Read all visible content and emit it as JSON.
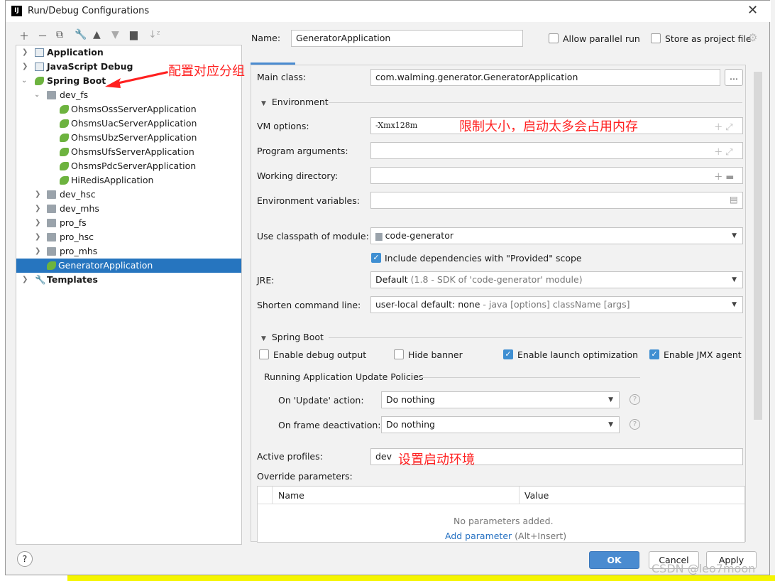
{
  "window": {
    "title": "Run/Debug Configurations",
    "logo": "IJ"
  },
  "toolbar": {
    "icons": [
      "plus-icon",
      "minus-icon",
      "copy-icon",
      "wrench-icon",
      "arrow-up-icon",
      "arrow-down-icon",
      "new-folder-icon",
      "sort-icon"
    ]
  },
  "tree": {
    "application": "Application",
    "js_debug": "JavaScript Debug",
    "spring_boot": "Spring Boot",
    "dev_fs": "dev_fs",
    "dev_fs_items": [
      "OhsmsOssServerApplication",
      "OhsmsUacServerApplication",
      "OhsmsUbzServerApplication",
      "OhsmsUfsServerApplication",
      "OhsmsPdcServerApplication",
      "HiRedisApplication"
    ],
    "folders": [
      "dev_hsc",
      "dev_mhs",
      "pro_fs",
      "pro_hsc",
      "pro_mhs"
    ],
    "selected": "GeneratorApplication",
    "templates": "Templates"
  },
  "annotations": {
    "group": "配置对应分组",
    "vm": "限制大小，启动太多会占用内存",
    "profile": "设置启动环境",
    "arrow_color": "#ff2020"
  },
  "form": {
    "name_label": "Name:",
    "name_value": "GeneratorApplication",
    "allow_parallel": "Allow parallel run",
    "store_project": "Store as project file",
    "main_class_label": "Main class:",
    "main_class_value": "com.walming.generator.GeneratorApplication",
    "browse": "...",
    "environment": "Environment",
    "vm_label": "VM options:",
    "vm_value": "-Xmx128m",
    "program_args_label": "Program arguments:",
    "working_dir_label": "Working directory:",
    "env_vars_label": "Environment variables:",
    "classpath_label": "Use classpath of module:",
    "classpath_value": "code-generator",
    "include_deps": "Include dependencies with \"Provided\" scope",
    "jre_label": "JRE:",
    "jre_value": "Default",
    "jre_hint": "(1.8 - SDK of 'code-generator' module)",
    "shorten_label": "Shorten command line:",
    "shorten_value": "user-local default: none",
    "shorten_hint": "- java [options] className [args]",
    "spring_boot": "Spring Boot",
    "debug_output": "Enable debug output",
    "hide_banner": "Hide banner",
    "launch_opt": "Enable launch optimization",
    "jmx": "Enable JMX agent",
    "policies": "Running Application Update Policies",
    "update_label": "On 'Update' action:",
    "update_value": "Do nothing",
    "frame_label": "On frame deactivation:",
    "frame_value": "Do nothing",
    "profiles_label": "Active profiles:",
    "profiles_value": "dev",
    "override_label": "Override parameters:",
    "col_name": "Name",
    "col_value": "Value",
    "empty": "No parameters added.",
    "add_param": "Add parameter",
    "add_hint": "(Alt+Insert)"
  },
  "checkboxes": {
    "allow_parallel": false,
    "store_project": false,
    "include_deps": true,
    "debug_output": false,
    "hide_banner": false,
    "launch_opt": true,
    "jmx": true
  },
  "footer": {
    "help": "?",
    "ok": "OK",
    "cancel": "Cancel",
    "apply": "Apply",
    "watermark": "CSDN @leo7moon"
  },
  "colors": {
    "accent": "#2675bf",
    "ok_button": "#4a8bd0"
  }
}
